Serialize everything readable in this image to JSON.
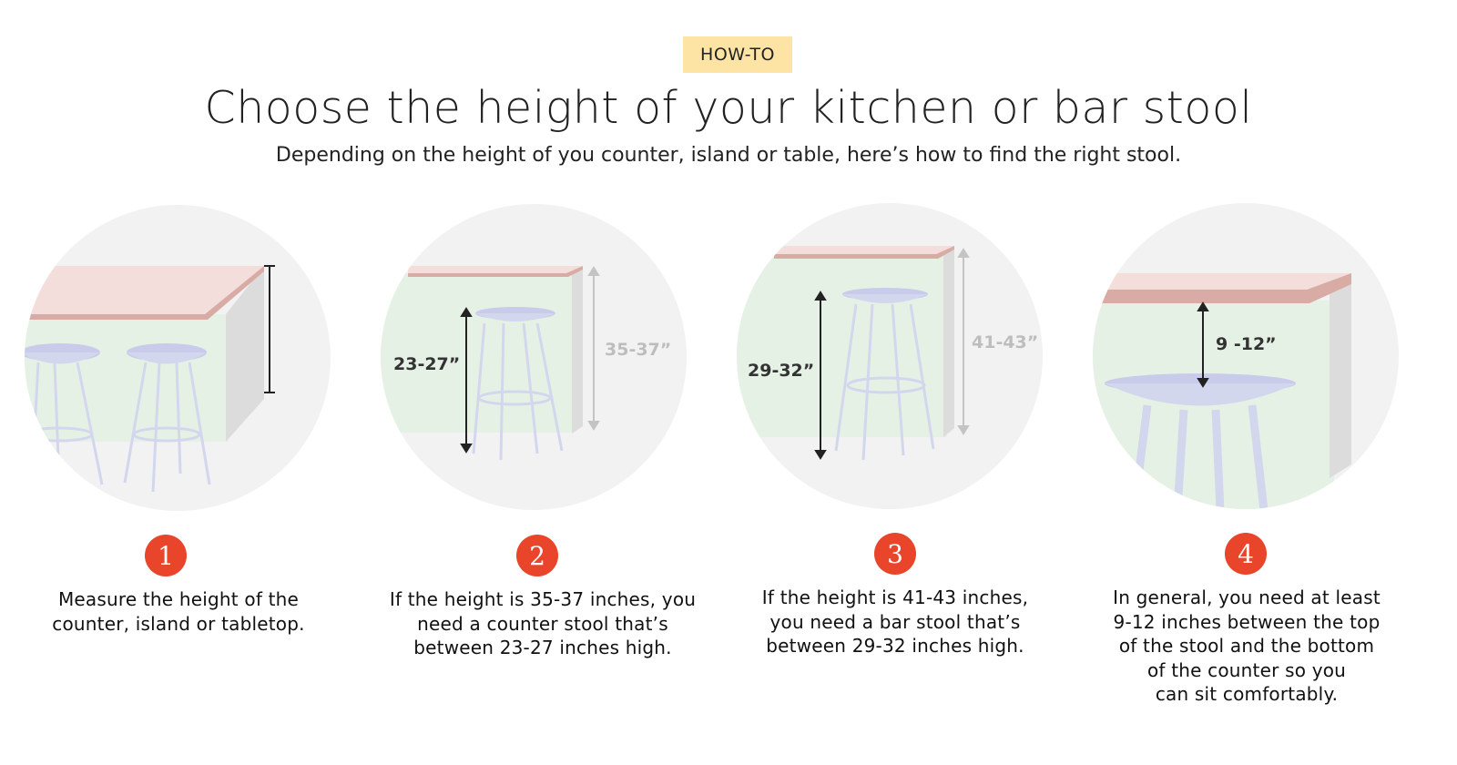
{
  "header": {
    "badge": "HOW-TO",
    "title": "Choose the height of your kitchen or bar stool",
    "subtitle": "Depending on the height of you counter, island or table, here’s how to find the right stool."
  },
  "steps": [
    {
      "number": "1",
      "text": "Measure the height of the\ncounter, island or tabletop."
    },
    {
      "number": "2",
      "text": "If the height is 35-37 inches, you\nneed a counter stool that’s\nbetween 23-27 inches high.",
      "stool_label": "23-27”",
      "counter_label": "35-37”"
    },
    {
      "number": "3",
      "text": "If the height is 41-43 inches,\nyou need a bar stool that’s\nbetween 29-32 inches high.",
      "stool_label": "29-32”",
      "counter_label": "41-43”"
    },
    {
      "number": "4",
      "text": "In general, you need at least\n9-12 inches between the top\nof the stool and the bottom\nof the counter so you\ncan sit comfortably.",
      "gap_label": "9 -12”"
    }
  ],
  "colors": {
    "badge_bg": "#fde3a4",
    "number_bg": "#e8452a",
    "circle_bg": "#f2f2f2",
    "wall_green": "#e6f1e6",
    "counter_top": "#f3dedb",
    "counter_edge": "#d9aba5",
    "stool_seat": "#c9cbeb",
    "stool_legs": "#d3d7ee"
  }
}
